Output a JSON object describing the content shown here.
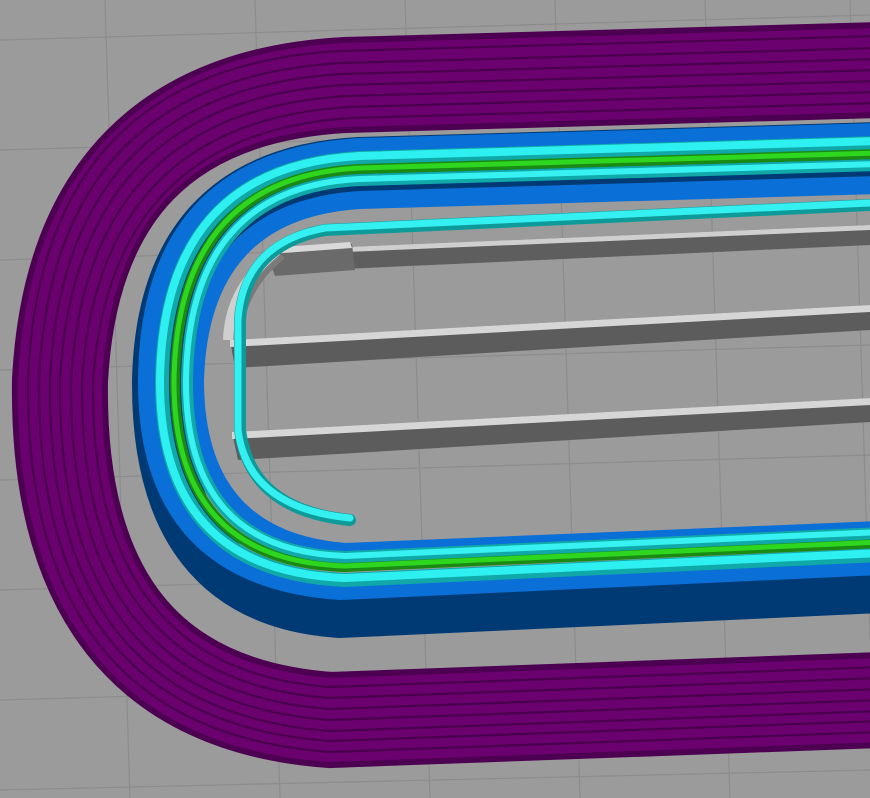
{
  "scene": {
    "background_color": "#9b9b9b",
    "grid_color": "#8e8e8e",
    "path_colors": {
      "skirt": "#6a006f",
      "skirt_dark": "#4a004e",
      "outer_wall": "#0a6fd6",
      "outer_wall_dark": "#004a8f",
      "inner_wall": "#22e6e6",
      "inner_wall_highlight": "#b8ffff",
      "fill_line": "#22c21a",
      "infill": "#6e6e6e",
      "infill_highlight": "#d8d8d8"
    }
  }
}
